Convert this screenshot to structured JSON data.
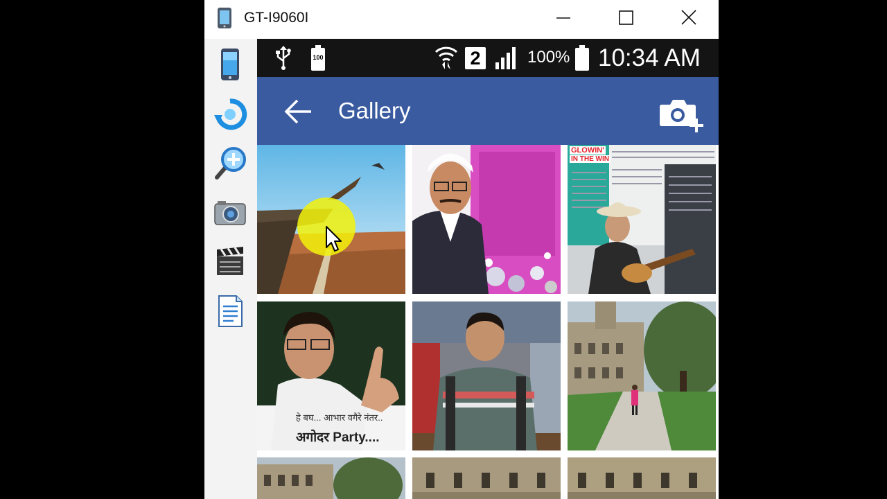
{
  "window": {
    "title": "GT-I9060I",
    "controls": {
      "minimize": "minimize",
      "maximize": "maximize",
      "close": "close"
    }
  },
  "sidebar": {
    "items": [
      {
        "name": "phone-icon"
      },
      {
        "name": "rotate-icon"
      },
      {
        "name": "zoom-icon"
      },
      {
        "name": "camera-icon"
      },
      {
        "name": "clapperboard-icon"
      },
      {
        "name": "document-icon"
      }
    ]
  },
  "status_bar": {
    "battery_small_label": "100",
    "sim_slot": "2",
    "battery_percent": "100%",
    "time": "10:34 AM"
  },
  "app_bar": {
    "title": "Gallery"
  },
  "gallery": {
    "tiles": [
      {
        "name": "photo-eagle-cliff"
      },
      {
        "name": "photo-birthday-man"
      },
      {
        "name": "photo-newspaper-guitarist",
        "heading_1": "GLOWIN'",
        "heading_2": "IN THE WIN"
      },
      {
        "name": "photo-man-pointing",
        "caption_line1": "हे बघ... आभार वगैरे नंतर..",
        "caption_line2": "अगोदर Party...."
      },
      {
        "name": "photo-man-backpack"
      },
      {
        "name": "photo-woman-park"
      },
      {
        "name": "photo-building-1"
      },
      {
        "name": "photo-building-2"
      },
      {
        "name": "photo-building-3"
      }
    ]
  },
  "colors": {
    "app_bar": "#3a5ba0",
    "status_bar": "#141414",
    "sidebar": "#f3f3f3",
    "cursor_highlight": "#f2f20a"
  }
}
